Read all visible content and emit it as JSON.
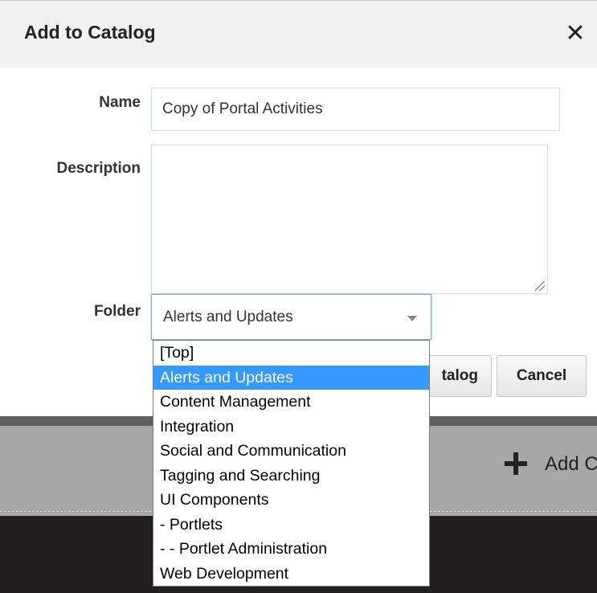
{
  "dialog": {
    "title": "Add to Catalog",
    "close_symbol": "✕"
  },
  "form": {
    "name_label": "Name",
    "name_value": "Copy of Portal Activities",
    "description_label": "Description",
    "description_value": "",
    "folder_label": "Folder",
    "folder_selected": "Alerts and Updates"
  },
  "buttons": {
    "add_catalog_partial": "talog",
    "cancel": "Cancel"
  },
  "background": {
    "add_label_partial": "Add C"
  },
  "folder_options": [
    {
      "label": "[Top]",
      "selected": false
    },
    {
      "label": "Alerts and Updates",
      "selected": true
    },
    {
      "label": "Content Management",
      "selected": false
    },
    {
      "label": "Integration",
      "selected": false
    },
    {
      "label": "Social and Communication",
      "selected": false
    },
    {
      "label": "Tagging and Searching",
      "selected": false
    },
    {
      "label": "UI Components",
      "selected": false
    },
    {
      "label": "- Portlets",
      "selected": false
    },
    {
      "label": "- - Portlet Administration",
      "selected": false
    },
    {
      "label": "Web Development",
      "selected": false
    }
  ],
  "colors": {
    "selection_highlight": "#3399ff",
    "header_background": "#f1f1f1",
    "select_focus_border": "#7fa9d0"
  },
  "icons": {
    "close": "close-icon",
    "dropdown": "chevron-down-icon",
    "add": "plus-icon",
    "resize": "resize-grip-icon"
  }
}
